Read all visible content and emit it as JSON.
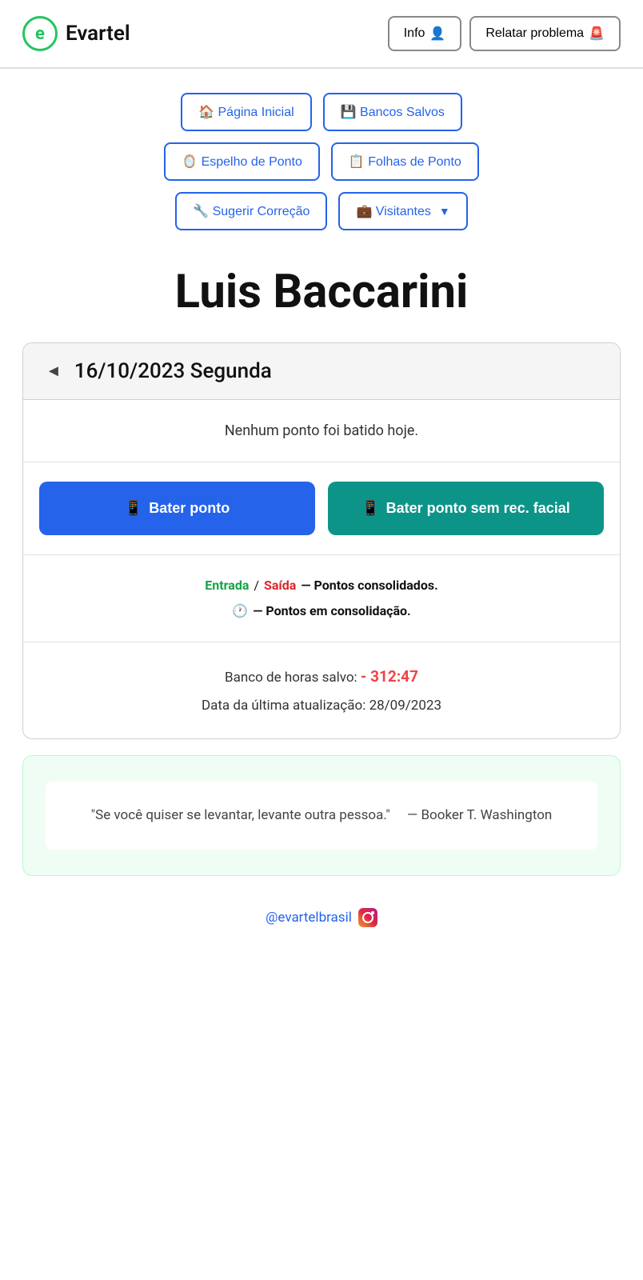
{
  "header": {
    "logo_letter": "e",
    "logo_name": "Evartel",
    "info_label": "Info",
    "info_icon": "👤",
    "report_label": "Relatar problema",
    "report_icon": "🚨"
  },
  "nav": {
    "pagina_inicial": "🏠 Página Inicial",
    "bancos_salvos": "💾 Bancos Salvos",
    "espelho_de_ponto": "🪞 Espelho de Ponto",
    "folhas_de_ponto": "📋 Folhas de Ponto",
    "sugerir_correcao": "🔧 Sugerir Correção",
    "visitantes": "💼 Visitantes"
  },
  "user": {
    "name": "Luis Baccarini"
  },
  "date_card": {
    "arrow_left": "◄",
    "date_text": "16/10/2023 Segunda",
    "no_punch_msg": "Nenhum ponto foi batido hoje.",
    "bater_ponto_label": "Bater ponto",
    "bater_ponto_icon": "📱",
    "bater_ponto_facial_label": "Bater ponto sem rec. facial",
    "bater_ponto_facial_icon": "📱",
    "legend_entrada": "Entrada",
    "legend_slash": "/",
    "legend_saida": "Saída",
    "legend_consolidated": "— Pontos consolidados.",
    "legend_clock": "🕐",
    "legend_consolidating": "— Pontos em consolidação.",
    "banco_horas_label": "Banco de horas salvo:",
    "banco_horas_value": "- 312:47",
    "ultima_atualizacao_label": "Data da última atualização:",
    "ultima_atualizacao_value": "28/09/2023"
  },
  "quote": {
    "text": "\"Se você quiser se levantar, levante outra pessoa.\"",
    "author": "— Booker T. Washington"
  },
  "footer": {
    "instagram_handle": "@evartelbrasil"
  }
}
